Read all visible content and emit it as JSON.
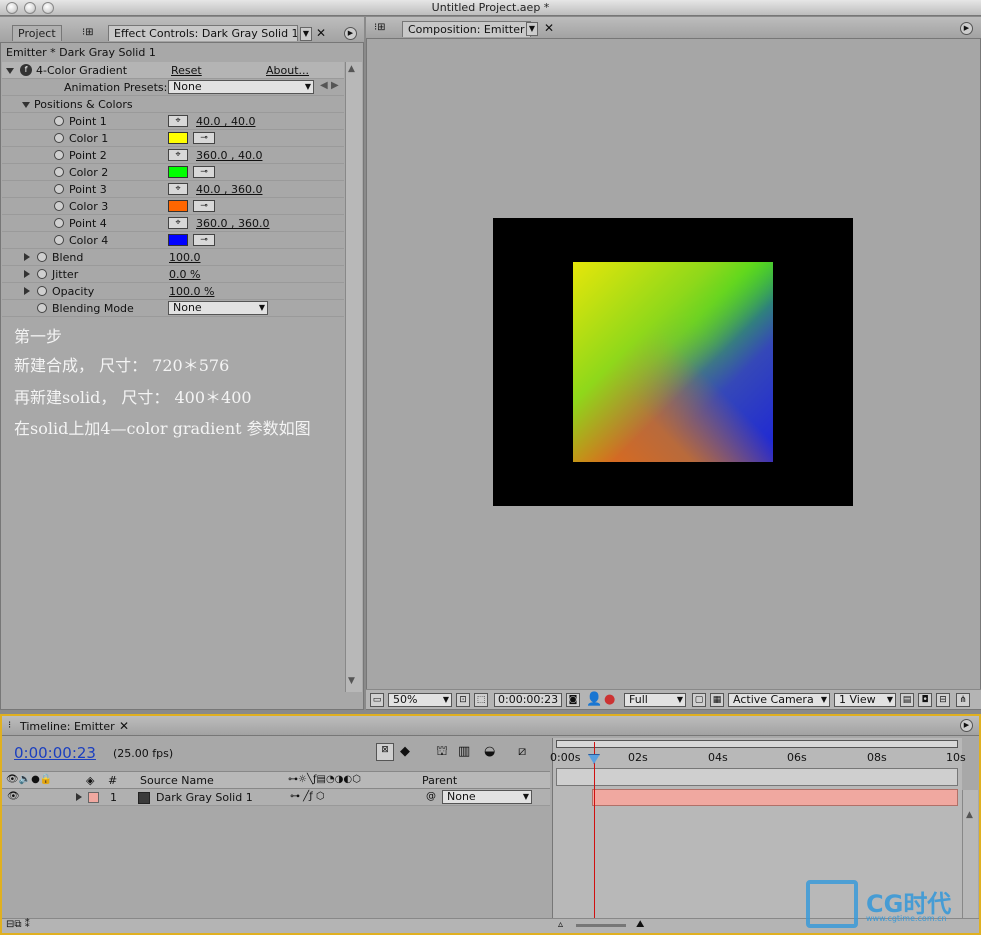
{
  "window": {
    "title": "Untitled Project.aep *"
  },
  "left_panel": {
    "tab_project": "Project",
    "tab_effect": "Effect Controls: Dark Gray Solid 1",
    "layer_path": "Emitter * Dark Gray Solid 1",
    "effect": {
      "name": "4-Color Gradient",
      "reset": "Reset",
      "about": "About..."
    },
    "animation_presets": {
      "label": "Animation Presets:",
      "value": "None"
    },
    "group_label": "Positions & Colors",
    "params": [
      {
        "label": "Point 1",
        "value": "40.0 , 40.0"
      },
      {
        "label": "Color 1",
        "color": "#ffff00"
      },
      {
        "label": "Point 2",
        "value": "360.0 , 40.0"
      },
      {
        "label": "Color 2",
        "color": "#00ff00"
      },
      {
        "label": "Point 3",
        "value": "40.0 , 360.0"
      },
      {
        "label": "Color 3",
        "color": "#ff6600"
      },
      {
        "label": "Point 4",
        "value": "360.0 , 360.0"
      },
      {
        "label": "Color 4",
        "color": "#0000ff"
      }
    ],
    "blend": {
      "label": "Blend",
      "value": "100.0"
    },
    "jitter": {
      "label": "Jitter",
      "value": "0.0 %"
    },
    "opacity": {
      "label": "Opacity",
      "value": "100.0 %"
    },
    "blending_mode": {
      "label": "Blending Mode",
      "value": "None"
    },
    "notes": [
      "第一步",
      "新建合成， 尺寸： 720＊576",
      "再新建solid， 尺寸： 400＊400",
      "在solid上加4—color gradient 参数如图"
    ]
  },
  "composition": {
    "tab": "Composition: Emitter",
    "zoom": "50%",
    "timecode": "0:00:00:23",
    "resolution": "Full",
    "camera": "Active Camera",
    "view": "1 View"
  },
  "timeline": {
    "tab": "Timeline: Emitter",
    "timecode": "0:00:00:23",
    "fps": "(25.00 fps)",
    "ruler": [
      "0:00s",
      "02s",
      "04s",
      "06s",
      "08s",
      "10s"
    ],
    "playhead_seconds": 0.92,
    "duration_seconds": 10,
    "headers": {
      "num": "#",
      "source": "Source Name",
      "parent": "Parent"
    },
    "layer": {
      "index": "1",
      "name": "Dark Gray Solid 1",
      "parent": "None",
      "label_color": "#f0a8a0"
    },
    "watermark": "CG时代",
    "watermark_url": "www.cgtime.com.cn"
  }
}
